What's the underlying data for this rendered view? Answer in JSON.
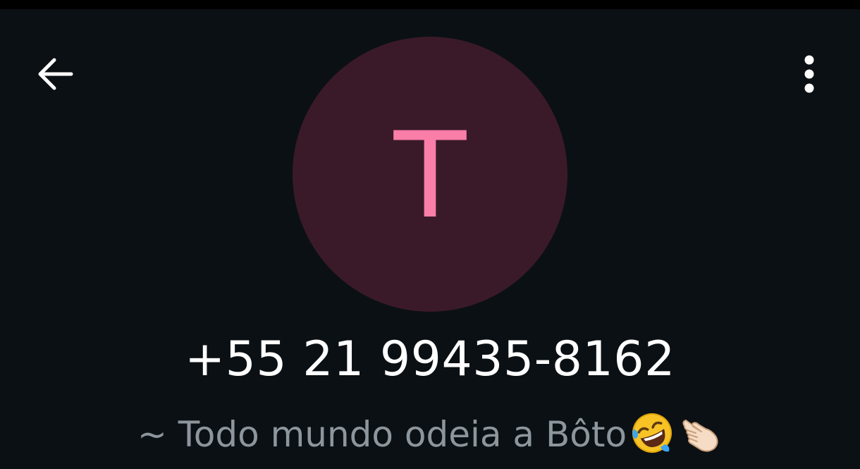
{
  "header": {
    "back_icon": "arrow-left-icon",
    "menu_icon": "more-vertical-icon"
  },
  "avatar": {
    "letter": "T",
    "background_color": "#3a1a29",
    "letter_color": "#fb7ea8"
  },
  "contact": {
    "phone": "+55 21 99435-8162",
    "about_text": "~ Todo mundo odeia a Bôto",
    "about_emojis": [
      "rolling-on-floor-laughing-emoji",
      "pointing-hand-emoji"
    ]
  },
  "colors": {
    "background": "#0b1014",
    "primary_text": "#ffffff",
    "secondary_text": "#8d969c"
  }
}
